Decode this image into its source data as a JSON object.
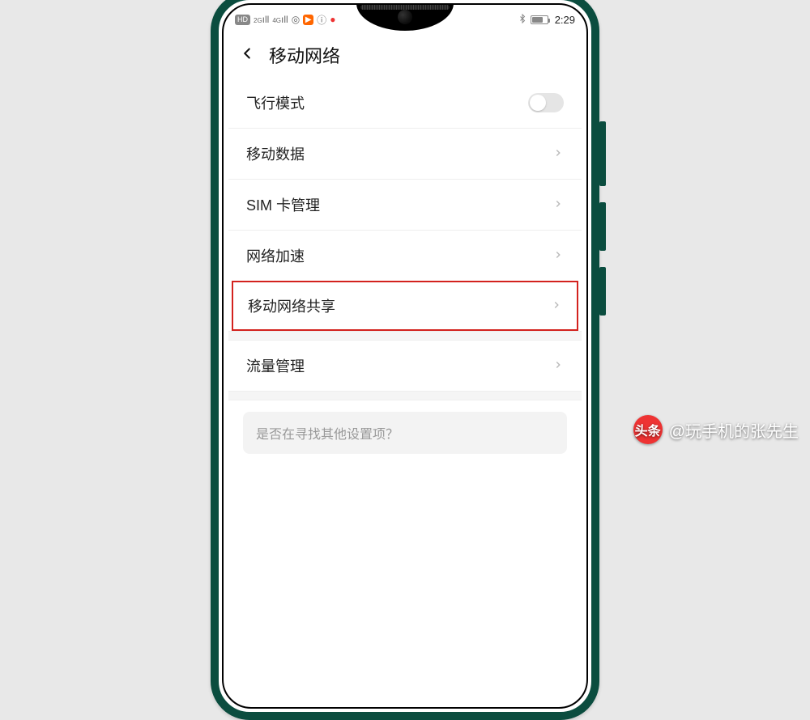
{
  "status_bar": {
    "hd_badge": "HD",
    "sig2g": "2G",
    "sig4g": "4G",
    "time": "2:29"
  },
  "header": {
    "title": "移动网络"
  },
  "settings": {
    "airplane_mode": "飞行模式",
    "mobile_data": "移动数据",
    "sim_management": "SIM 卡管理",
    "network_accel": "网络加速",
    "mobile_hotspot": "移动网络共享",
    "data_usage": "流量管理"
  },
  "search_hint": "是否在寻找其他设置项？",
  "watermark": {
    "logo_text": "头条",
    "text": "@玩手机的张先生"
  }
}
